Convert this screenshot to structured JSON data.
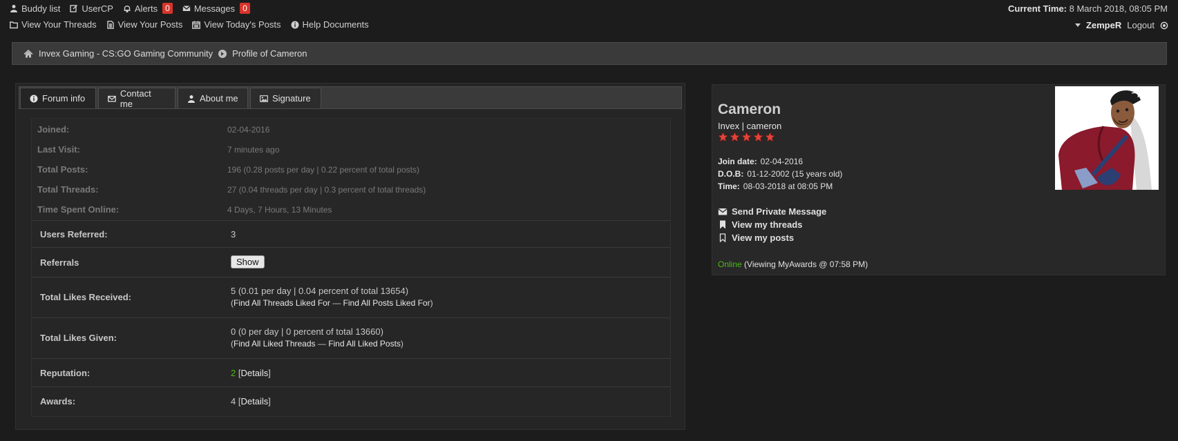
{
  "topnav": {
    "buddy_list": "Buddy list",
    "usercp": "UserCP",
    "alerts": "Alerts",
    "alerts_count": "0",
    "messages": "Messages",
    "messages_count": "0",
    "view_threads": "View Your Threads",
    "view_posts": "View Your Posts",
    "todays_posts": "View Today's Posts",
    "help": "Help Documents",
    "current_time_label": "Current Time:",
    "current_time_value": "8 March 2018, 08:05 PM",
    "username": "ZempeR",
    "logout": "Logout"
  },
  "breadcrumb": {
    "home": "Invex Gaming - CS:GO Gaming Community",
    "current": "Profile of Cameron"
  },
  "tabs": {
    "forum_info": "Forum info",
    "contact": "Contact me",
    "about": "About me",
    "signature": "Signature"
  },
  "info": {
    "joined_label": "Joined:",
    "joined_value": "02-04-2016",
    "last_visit_label": "Last Visit:",
    "last_visit_value": "7 minutes ago",
    "total_posts_label": "Total Posts:",
    "total_posts_value": "196 (0.28 posts per day | 0.22 percent of total posts)",
    "total_threads_label": "Total Threads:",
    "total_threads_value": "27 (0.04 threads per day | 0.3 percent of total threads)",
    "time_online_label": "Time Spent Online:",
    "time_online_value": "4 Days, 7 Hours, 13 Minutes",
    "users_referred_label": "Users Referred:",
    "users_referred_value": "3",
    "referrals_label": "Referrals",
    "referrals_button": "Show",
    "likes_received_label": "Total Likes Received:",
    "likes_received_value": "5 (0.01 per day | 0.04 percent of total 13654)",
    "likes_received_link1": "Find All Threads Liked For",
    "likes_received_link2": "Find All Posts Liked For",
    "likes_given_label": "Total Likes Given:",
    "likes_given_value": "0 (0 per day | 0 percent of total 13660)",
    "likes_given_link1": "Find All Liked Threads",
    "likes_given_link2": "Find All Liked Posts",
    "reputation_label": "Reputation:",
    "reputation_value": "2",
    "reputation_details": "Details",
    "awards_label": "Awards:",
    "awards_value": "4",
    "awards_details": "Details"
  },
  "profile": {
    "name": "Cameron",
    "usertitle": "Invex | cameron",
    "stars": 5,
    "star_color": "#e0443a",
    "join_label": "Join date:",
    "join_value": "02-04-2016",
    "dob_label": "D.O.B:",
    "dob_value": "01-12-2002 (15 years old)",
    "time_label": "Time:",
    "time_value": "08-03-2018 at 08:05 PM",
    "pm_link": "Send Private Message",
    "threads_link": "View my threads",
    "posts_link": "View my posts",
    "status_online": "Online",
    "status_activity": "(Viewing MyAwards @ 07:58 PM)"
  }
}
